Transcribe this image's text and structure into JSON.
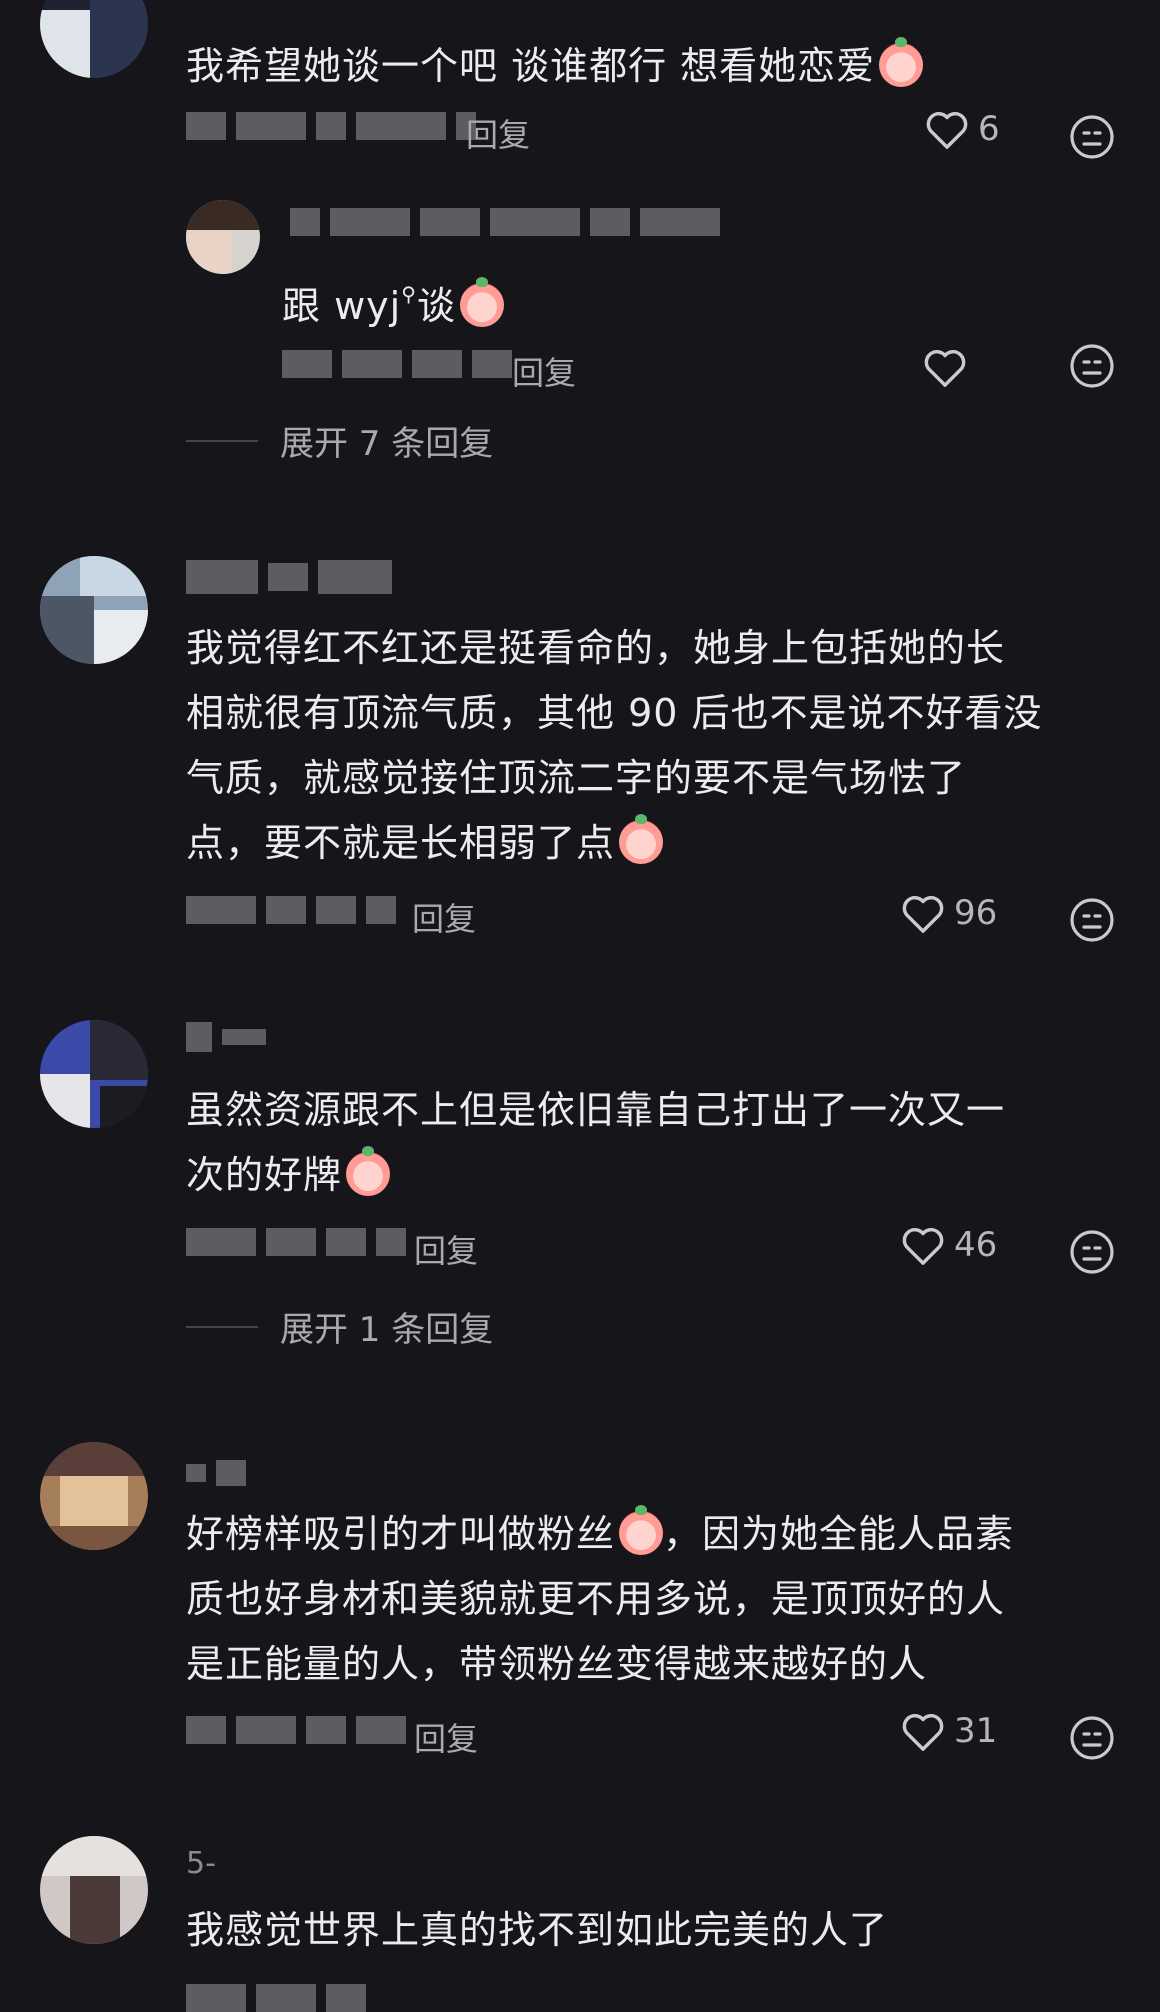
{
  "comments": [
    {
      "text": "我希望她谈一个吧 谈谁都行 想看她恋爱",
      "meta": "回复",
      "likes": "6",
      "reply": {
        "text": "跟 wyj",
        "text_suffix": "谈",
        "meta": "回复"
      },
      "expand_label": "展开 7 条回复"
    },
    {
      "text_lines": [
        "我觉得红不红还是挺看命的，她身上包括她的长",
        "相就很有顶流气质，其他 90 后也不是说不好看没",
        "气质，就感觉接住顶流二字的要不是气场怯了",
        "点，要不就是长相弱了点"
      ],
      "meta": "回复",
      "likes": "96"
    },
    {
      "text_lines": [
        "虽然资源跟不上但是依旧靠自己打出了一次又一",
        "次的好牌"
      ],
      "meta": "回复",
      "likes": "46",
      "expand_label": "展开 1 条回复"
    },
    {
      "text_lines": [
        "好榜样吸引的才叫做粉丝",
        "，因为她全能人品素",
        "质也好身材和美貌就更不用多说，是顶顶好的人",
        "是正能量的人，带领粉丝变得越来越好的人"
      ],
      "meta": "回复",
      "likes": "31"
    },
    {
      "username": "5-",
      "text": "我感觉世界上真的找不到如此完美的人了"
    }
  ],
  "icons": {
    "like": "heart-outline-icon",
    "dislike": "frown-face-icon",
    "emoji": "peach-emoji-icon",
    "search": "search-icon"
  },
  "colors": {
    "background": "#16161a",
    "text": "#ececef",
    "muted": "#8a8a92"
  }
}
